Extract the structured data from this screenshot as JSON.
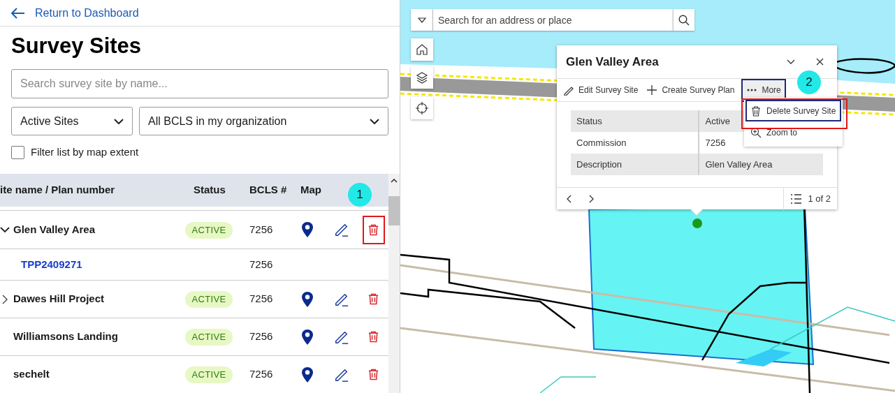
{
  "back_link": {
    "label": "Return to Dashboard"
  },
  "title": "Survey Sites",
  "search": {
    "placeholder": "Search survey site by name..."
  },
  "filters": [
    {
      "value": "Active Sites"
    },
    {
      "value": "All BCLS in my organization"
    }
  ],
  "map_extent_filter": {
    "label": "Filter list by map extent",
    "checked": false
  },
  "table": {
    "columns": [
      "ite name / Plan number",
      "Status",
      "BCLS #",
      "Map"
    ],
    "rows": [
      {
        "kind": "site",
        "name": "Glen Valley Area",
        "expanded": true,
        "status": "ACTIVE",
        "bcls": "7256",
        "delete_highlighted": true
      },
      {
        "kind": "plan",
        "name": "TPP2409271",
        "bcls": "7256"
      },
      {
        "kind": "site",
        "name": "Dawes Hill Project",
        "expanded": false,
        "status": "ACTIVE",
        "bcls": "7256",
        "delete_highlighted": false
      },
      {
        "kind": "site",
        "name": "Williamsons Landing",
        "status": "ACTIVE",
        "bcls": "7256",
        "delete_highlighted": false
      },
      {
        "kind": "site",
        "name": "sechelt",
        "status": "ACTIVE",
        "bcls": "7256",
        "delete_highlighted": false
      }
    ]
  },
  "step_badges": [
    "1",
    "2"
  ],
  "map": {
    "search_placeholder": "Search for an address or place",
    "popup": {
      "title": "Glen Valley Area",
      "actions": [
        {
          "kind": "edit",
          "label": "Edit Survey Site",
          "selected": false
        },
        {
          "kind": "add",
          "label": "Create Survey Plan",
          "selected": false
        },
        {
          "kind": "more",
          "label": "More",
          "selected": true
        }
      ],
      "attributes": [
        {
          "field": "Status",
          "value": "Active"
        },
        {
          "field": "Commission",
          "value": "7256"
        },
        {
          "field": "Description",
          "value": "Glen Valley Area"
        }
      ],
      "menu": [
        {
          "kind": "delete",
          "label": "Delete Survey Site",
          "highlighted": true
        },
        {
          "kind": "zoom",
          "label": "Zoom to",
          "highlighted": false
        }
      ],
      "pager": "1 of 2"
    }
  }
}
